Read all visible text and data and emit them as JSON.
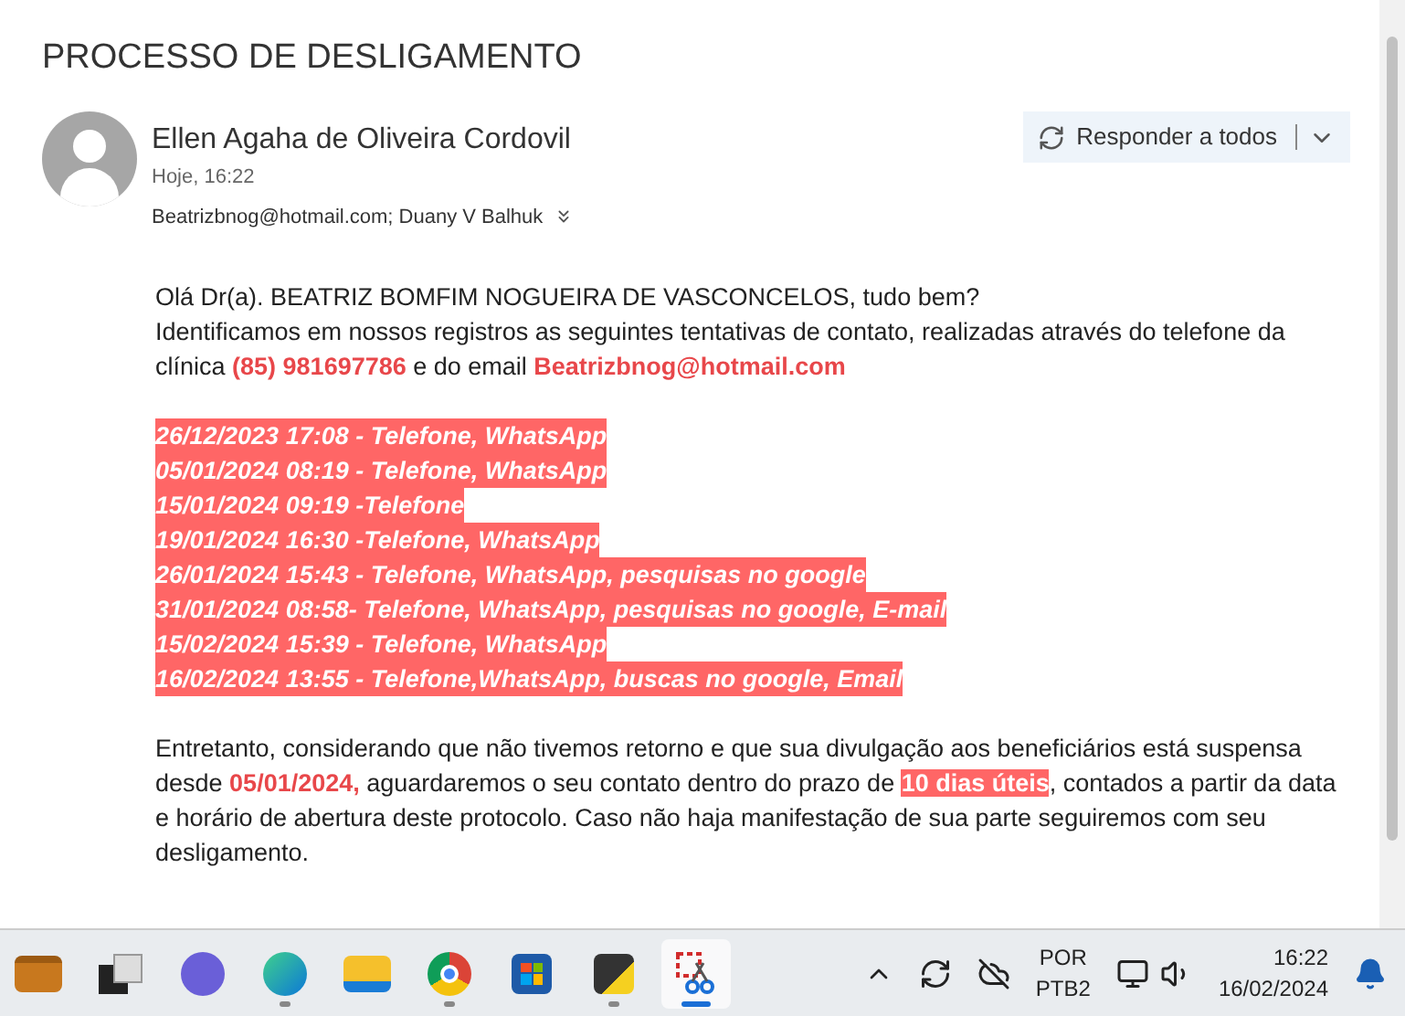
{
  "subject": "PROCESSO DE DESLIGAMENTO",
  "message": {
    "sender": "Ellen Agaha de Oliveira Cordovil",
    "time": "Hoje, 16:22",
    "recipients": "Beatrizbnog@hotmail.com; Duany V Balhuk",
    "reply_button": "Responder a todos"
  },
  "body": {
    "intro": [
      [
        {
          "kind": "plain",
          "text": "Olá Dr(a). BEATRIZ BOMFIM NOGUEIRA DE VASCONCELOS, tudo bem?"
        }
      ],
      [
        {
          "kind": "plain",
          "text": "Identificamos em nossos registros as seguintes tentativas de contato, realizadas através do telefone da clínica "
        },
        {
          "kind": "red",
          "text": "(85) 981697786"
        },
        {
          "kind": "plain",
          "text": " e do email  "
        },
        {
          "kind": "red",
          "text": "Beatrizbnog@hotmail.com"
        }
      ]
    ],
    "attempts": [
      "26/12/2023 17:08 - Telefone, WhatsApp",
      "05/01/2024 08:19 - Telefone, WhatsApp",
      "15/01/2024 09:19 -Telefone",
      "19/01/2024 16:30 -Telefone, WhatsApp",
      "26/01/2024 15:43 - Telefone, WhatsApp, pesquisas no google",
      "31/01/2024 08:58- Telefone, WhatsApp, pesquisas no google, E-mail",
      "15/02/2024 15:39 - Telefone, WhatsApp",
      "16/02/2024 13:55 - Telefone,WhatsApp, buscas no google, Email"
    ],
    "closing": [
      {
        "kind": "plain",
        "text": "Entretanto, considerando que não tivemos retorno e que sua divulgação aos beneficiários está suspensa desde "
      },
      {
        "kind": "red",
        "text": "05/01/2024,"
      },
      {
        "kind": "plain",
        "text": " aguardaremos o seu contato dentro do prazo de "
      },
      {
        "kind": "highlight",
        "text": "10 dias úteis"
      },
      {
        "kind": "plain",
        "text": ", contados a partir da data e horário de abertura deste protocolo. Caso não haja manifestação de sua parte seguiremos com seu desligamento."
      }
    ]
  },
  "taskbar": {
    "apps": [
      {
        "kind": "briefcase",
        "running": false,
        "selected": false
      },
      {
        "kind": "taskview",
        "running": false,
        "selected": false
      },
      {
        "kind": "meet",
        "running": false,
        "selected": false
      },
      {
        "kind": "edge",
        "running": true,
        "selected": false
      },
      {
        "kind": "folder",
        "running": false,
        "selected": false
      },
      {
        "kind": "chrome",
        "running": true,
        "selected": false
      },
      {
        "kind": "store",
        "running": false,
        "selected": false
      },
      {
        "kind": "notes",
        "running": true,
        "selected": false
      },
      {
        "kind": "snip",
        "running": true,
        "selected": true
      }
    ],
    "language": "POR",
    "layout": "PTB2",
    "time": "16:22",
    "date": "16/02/2024"
  }
}
